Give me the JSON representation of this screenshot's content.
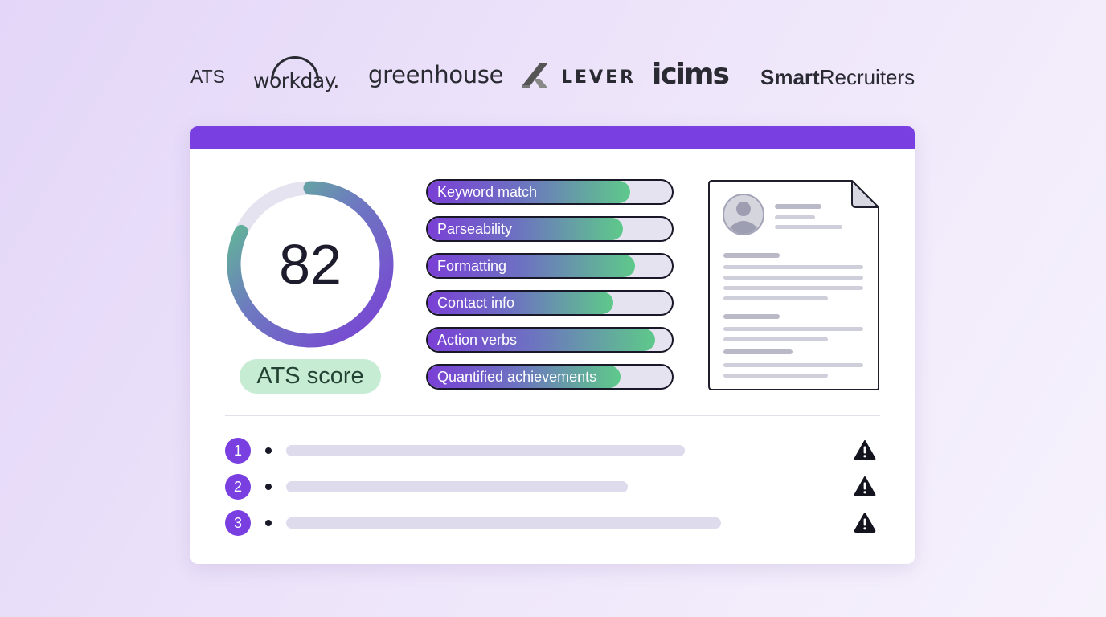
{
  "logos": {
    "ats": "ATS",
    "workday": "workday.",
    "greenhouse": "greenhouse",
    "lever": "LEVER",
    "icims": "icims",
    "smartrecruiters_bold": "Smart",
    "smartrecruiters_rest": "Recruiters"
  },
  "score": {
    "value": "82",
    "fraction": 0.82,
    "label": "ATS score"
  },
  "metrics": [
    {
      "label": "Keyword match",
      "fill": 0.83
    },
    {
      "label": "Parseability",
      "fill": 0.8
    },
    {
      "label": "Formatting",
      "fill": 0.85
    },
    {
      "label": "Contact info",
      "fill": 0.76
    },
    {
      "label": "Action verbs",
      "fill": 0.93
    },
    {
      "label": "Quantified achievements",
      "fill": 0.79
    }
  ],
  "issues": [
    {
      "number": "1"
    },
    {
      "number": "2"
    },
    {
      "number": "3"
    }
  ],
  "icons": {
    "warning": "warning-icon",
    "avatar": "avatar-icon",
    "document": "resume-document-icon"
  },
  "colors": {
    "accent": "#7a3fe0",
    "success": "#5ec98a",
    "pill": "#c6ecd3"
  }
}
